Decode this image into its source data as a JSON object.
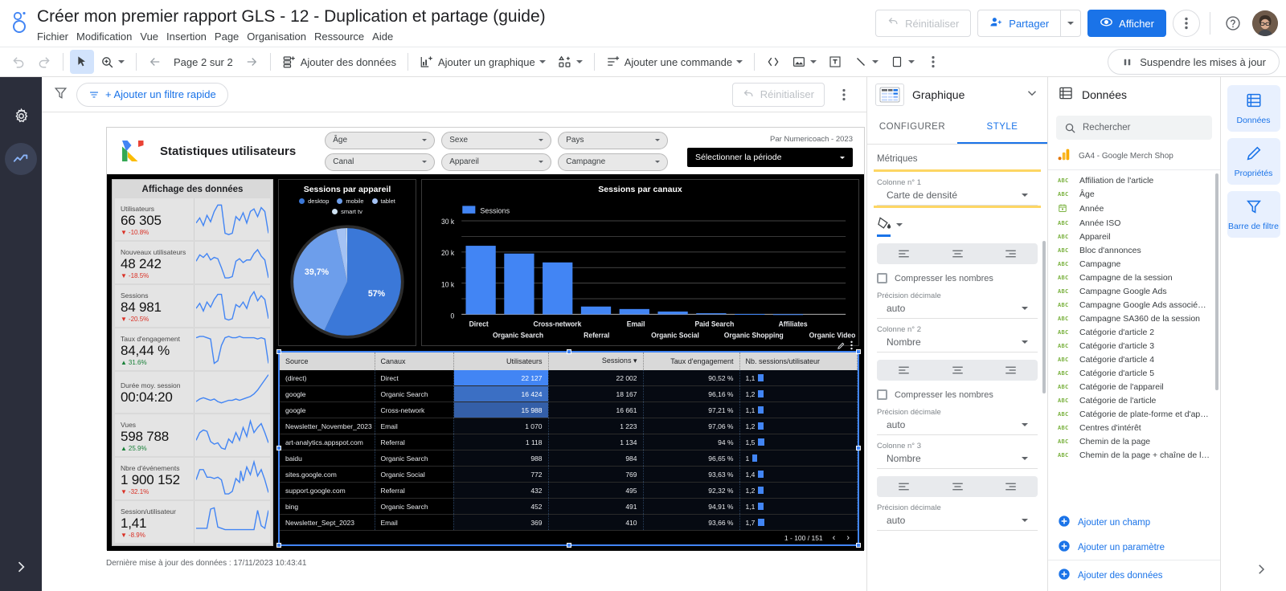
{
  "app": {
    "doc_title": "Créer mon premier rapport GLS - 12 - Duplication et partage (guide)",
    "menu": [
      "Fichier",
      "Modification",
      "Vue",
      "Insertion",
      "Page",
      "Organisation",
      "Ressource",
      "Aide"
    ],
    "actions": {
      "reset": "Réinitialiser",
      "share": "Partager",
      "view": "Afficher"
    }
  },
  "toolbar": {
    "page_indicator": "Page 2 sur 2",
    "add_data": "Ajouter des données",
    "add_chart": "Ajouter un graphique",
    "add_control": "Ajouter une commande",
    "pause_updates": "Suspendre les mises à jour"
  },
  "filterbar": {
    "add_quick_filter": "+ Ajouter un filtre rapide",
    "reset": "Réinitialiser"
  },
  "report": {
    "title": "Statistiques utilisateurs",
    "credit": "Par Numericoach - 2023",
    "date_control": "Sélectionner la période",
    "filters": [
      "Âge",
      "Sexe",
      "Pays",
      "Canal",
      "Appareil",
      "Campagne"
    ],
    "status": "Dernière mise à jour des données : 17/11/2023 10:43:41"
  },
  "scorecards": {
    "panel_title": "Affichage des données",
    "items": [
      {
        "label": "Utilisateurs",
        "value": "66 305",
        "delta": "-10.8%",
        "dir": "down",
        "spark": "0,18 6,14 12,20 18,12 24,17 30,9 36,4 42,4 48,26 54,27 60,26 66,13 72,16 78,10 84,18 90,9 96,7 102,13 108,6 114,9 120,26"
      },
      {
        "label": "Nouveaux utilisateurs",
        "value": "48 242",
        "delta": "-18.5%",
        "dir": "down",
        "spark": "0,14 6,9 12,11 18,8 24,13 30,11 36,12 42,19 48,27 54,27 60,26 66,14 72,12 78,15 84,13 90,13 96,8 102,5 108,10 114,13 120,27"
      },
      {
        "label": "Sessions",
        "value": "84 981",
        "delta": "-20.5%",
        "dir": "down",
        "spark": "0,17 6,13 12,19 18,12 24,16 30,10 36,6 42,6 48,25 54,26 60,25 66,14 72,16 78,12 84,17 90,8 96,4 102,11 108,7 114,10 120,25"
      },
      {
        "label": "Taux d'engagement",
        "value": "84,44 %",
        "delta": "31.6%",
        "dir": "up",
        "spark": "0,6 6,5 12,5 18,6 24,7 30,26 36,24 42,12 48,6 54,5 60,6 66,6 72,5 78,6 84,6 90,6 96,6 102,7 108,6 114,7 120,26"
      },
      {
        "label": "Durée moy. session",
        "value": "00:04:20",
        "delta": "",
        "dir": "none",
        "spark": "0,22 6,20 12,19 18,20 24,21 30,20 36,22 42,23 48,22 54,21 60,21 66,20 72,21 78,20 84,19 90,18 96,16 102,13 108,9 114,5 120,1"
      },
      {
        "label": "Vues",
        "value": "598 788",
        "delta": "25.9%",
        "dir": "up",
        "spark": "0,19 6,13 12,11 18,12 24,20 30,22 36,21 42,25 48,26 54,18 60,21 66,13 72,19 78,9 84,16 90,4 96,13 102,9 108,6 114,13 120,21"
      },
      {
        "label": "Nbre d'événements",
        "value": "1 900 152",
        "delta": "-32.1%",
        "dir": "down",
        "spark": "0,16 6,8 12,8 18,14 24,14 30,15 36,14 42,16 48,27 54,27 60,25 66,15 72,18 74,9 78,17 84,6 90,12 96,2 102,13 108,8 114,16 120,26"
      },
      {
        "label": "Session/utilisateur",
        "value": "1,41",
        "delta": "-8.9%",
        "dir": "down",
        "spark": "0,20 6,20 12,20 18,20 24,5 30,4 36,19 42,20 48,21 54,21 60,21 66,21 72,21 78,21 84,21 90,21 96,21 102,6 108,18 114,20 120,6"
      }
    ]
  },
  "chart_data": [
    {
      "type": "pie",
      "title": "Sessions par appareil",
      "legend": [
        "desktop",
        "mobile",
        "tablet",
        "smart tv"
      ],
      "legend_position": "top",
      "labels": [
        "desktop",
        "mobile",
        "tablet",
        "smart tv"
      ],
      "values": [
        57.0,
        39.7,
        3.0,
        0.3
      ],
      "value_labels": [
        "57%",
        "39,7%",
        "",
        ""
      ],
      "colors": [
        "#3b78d8",
        "#6d9eeb",
        "#a4c2f4",
        "#cfe2f3"
      ]
    },
    {
      "type": "bar",
      "title": "Sessions par canaux",
      "legend": [
        "Sessions"
      ],
      "series": [
        {
          "name": "Sessions",
          "values": [
            22002,
            19500,
            16661,
            2500,
            1700,
            900,
            350,
            120,
            60
          ]
        }
      ],
      "categories": [
        "Direct",
        "Organic Search",
        "Cross-network",
        "Referral",
        "Email",
        "Organic Social",
        "Paid Search",
        "Organic Shopping",
        "Affiliates",
        "Organic Video"
      ],
      "x_tick_labels_top": [
        "Direct",
        "Cross-network",
        "Email",
        "Paid Search",
        "Affiliates"
      ],
      "x_tick_labels_bottom": [
        "Organic Search",
        "Referral",
        "Organic Social",
        "Organic Shopping",
        "Organic Video"
      ],
      "ylim": [
        0,
        30000
      ],
      "ytick_labels": [
        "30 k",
        "20 k",
        "10 k",
        "0"
      ],
      "ytick_values": [
        30000,
        20000,
        10000,
        0
      ],
      "xlabel": "",
      "ylabel": "",
      "grid": true,
      "bar_color": "#4285f4"
    },
    {
      "type": "table",
      "columns": [
        "Source",
        "Canaux",
        "Utilisateurs",
        "Sessions",
        "Taux d'engagement",
        "Nb. sessions/utilisateur"
      ],
      "sorted_column": "Sessions",
      "rows": [
        {
          "source": "(direct)",
          "canaux": "Direct",
          "utilisateurs": "22 127",
          "sessions": "22 002",
          "taux": "90,52 %",
          "ratio": "1,1",
          "heat": 1
        },
        {
          "source": "google",
          "canaux": "Organic Search",
          "utilisateurs": "16 424",
          "sessions": "18 167",
          "taux": "96,16 %",
          "ratio": "1,2",
          "heat": 2
        },
        {
          "source": "google",
          "canaux": "Cross-network",
          "utilisateurs": "15 988",
          "sessions": "16 661",
          "taux": "97,21 %",
          "ratio": "1,1",
          "heat": 3
        },
        {
          "source": "Newsletter_November_2023",
          "canaux": "Email",
          "utilisateurs": "1 070",
          "sessions": "1 223",
          "taux": "97,06 %",
          "ratio": "1,2",
          "heat": 0
        },
        {
          "source": "art-analytics.appspot.com",
          "canaux": "Referral",
          "utilisateurs": "1 118",
          "sessions": "1 134",
          "taux": "94 %",
          "ratio": "1,5",
          "heat": 0
        },
        {
          "source": "baidu",
          "canaux": "Organic Search",
          "utilisateurs": "988",
          "sessions": "984",
          "taux": "96,65 %",
          "ratio": "1",
          "heat": 0
        },
        {
          "source": "sites.google.com",
          "canaux": "Organic Social",
          "utilisateurs": "772",
          "sessions": "769",
          "taux": "93,63 %",
          "ratio": "1,4",
          "heat": 0
        },
        {
          "source": "support.google.com",
          "canaux": "Referral",
          "utilisateurs": "432",
          "sessions": "495",
          "taux": "92,32 %",
          "ratio": "1,2",
          "heat": 0
        },
        {
          "source": "bing",
          "canaux": "Organic Search",
          "utilisateurs": "452",
          "sessions": "491",
          "taux": "94,91 %",
          "ratio": "1,1",
          "heat": 0
        },
        {
          "source": "Newsletter_Sept_2023",
          "canaux": "Email",
          "utilisateurs": "369",
          "sessions": "410",
          "taux": "93,66 %",
          "ratio": "1,7",
          "heat": 0
        }
      ],
      "pagination": "1 - 100 / 151"
    }
  ],
  "properties": {
    "panel_title": "Graphique",
    "tabs": [
      "CONFIGURER",
      "STYLE"
    ],
    "active_tab": "STYLE",
    "section_metrics": "Métriques",
    "groups": [
      {
        "column_label": "Colonne n° 1",
        "type_value": "Carte de densité",
        "compress_label": "Compresser les nombres",
        "precision_label": "Précision décimale",
        "precision_value": "auto"
      },
      {
        "column_label": "Colonne n° 2",
        "type_value": "Nombre",
        "compress_label": "Compresser les nombres",
        "precision_label": "Précision décimale",
        "precision_value": "auto"
      },
      {
        "column_label": "Colonne n° 3",
        "type_value": "Nombre",
        "compress_label": "",
        "precision_label": "Précision décimale",
        "precision_value": "auto"
      }
    ]
  },
  "data_panel": {
    "title": "Données",
    "search_placeholder": "Rechercher",
    "source": "GA4 - Google Merch Shop",
    "fields": [
      {
        "type": "ABC",
        "name": "Affiliation de l'article",
        "kind": "text"
      },
      {
        "type": "ABC",
        "name": "Âge",
        "kind": "text"
      },
      {
        "type": "CAL",
        "name": "Année",
        "kind": "date"
      },
      {
        "type": "ABC",
        "name": "Année ISO",
        "kind": "text"
      },
      {
        "type": "ABC",
        "name": "Appareil",
        "kind": "text"
      },
      {
        "type": "ABC",
        "name": "Bloc d'annonces",
        "kind": "text"
      },
      {
        "type": "ABC",
        "name": "Campagne",
        "kind": "text"
      },
      {
        "type": "ABC",
        "name": "Campagne de la session",
        "kind": "text"
      },
      {
        "type": "ABC",
        "name": "Campagne Google Ads",
        "kind": "text"
      },
      {
        "type": "ABC",
        "name": "Campagne Google Ads associée à c...",
        "kind": "text"
      },
      {
        "type": "ABC",
        "name": "Campagne SA360 de la session",
        "kind": "text"
      },
      {
        "type": "ABC",
        "name": "Catégorie d'article 2",
        "kind": "text"
      },
      {
        "type": "ABC",
        "name": "Catégorie d'article 3",
        "kind": "text"
      },
      {
        "type": "ABC",
        "name": "Catégorie d'article 4",
        "kind": "text"
      },
      {
        "type": "ABC",
        "name": "Catégorie d'article 5",
        "kind": "text"
      },
      {
        "type": "ABC",
        "name": "Catégorie de l'appareil",
        "kind": "text"
      },
      {
        "type": "ABC",
        "name": "Catégorie de l'article",
        "kind": "text"
      },
      {
        "type": "ABC",
        "name": "Catégorie de plate-forme et d'appareil",
        "kind": "text"
      },
      {
        "type": "ABC",
        "name": "Centres d'intérêt",
        "kind": "text"
      },
      {
        "type": "ABC",
        "name": "Chemin de la page",
        "kind": "text"
      },
      {
        "type": "ABC",
        "name": "Chemin de la page + chaîne de la re...",
        "kind": "text"
      }
    ],
    "add_field": "Ajouter un champ",
    "add_parameter": "Ajouter un paramètre",
    "add_data": "Ajouter des données"
  },
  "right_rail": {
    "items": [
      {
        "label": "Données",
        "icon": "data-icon"
      },
      {
        "label": "Propriétés",
        "icon": "pencil-icon"
      },
      {
        "label": "Barre de filtre",
        "icon": "filter-icon"
      }
    ]
  }
}
